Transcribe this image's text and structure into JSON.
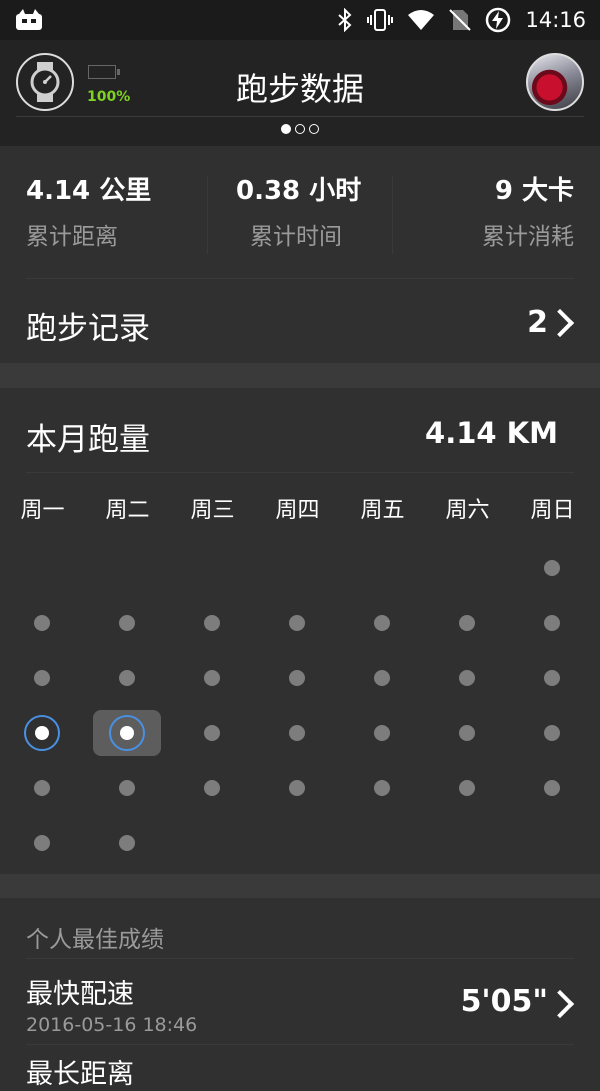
{
  "status_bar": {
    "time": "14:16"
  },
  "header": {
    "title": "跑步数据",
    "battery_percent": "100%"
  },
  "pager": {
    "pages": 3,
    "active": 0
  },
  "stats": [
    {
      "value": "4.14  公里",
      "label": "累计距离"
    },
    {
      "value": "0.38  小时",
      "label": "累计时间"
    },
    {
      "value": "9  大卡",
      "label": "累计消耗"
    }
  ],
  "records": {
    "label": "跑步记录",
    "count": "2"
  },
  "month": {
    "title": "本月跑量",
    "total": "4.14 KM",
    "weekdays": [
      "周一",
      "周二",
      "周三",
      "周四",
      "周五",
      "周六",
      "周日"
    ]
  },
  "best": {
    "header": "个人最佳成绩",
    "items": [
      {
        "name": "最快配速",
        "date": "2016-05-16 18:46",
        "value": "5'05\""
      },
      {
        "name": "最长距离"
      }
    ]
  },
  "colors": {
    "accent_ring": "#4a90e2",
    "battery_text": "#7ed321",
    "background": "#303030"
  }
}
